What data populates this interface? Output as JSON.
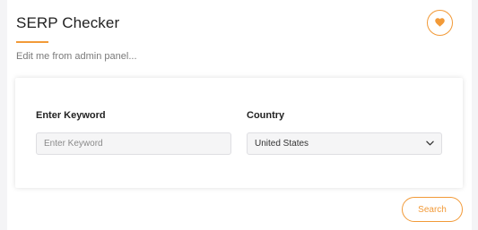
{
  "header": {
    "title": "SERP Checker",
    "subtitle": "Edit me from admin panel...",
    "favorite_icon": "heart-icon"
  },
  "form": {
    "keyword_label": "Enter Keyword",
    "keyword_placeholder": "Enter Keyword",
    "keyword_value": "",
    "country_label": "Country",
    "country_selected": "United States",
    "country_icon": "chevron-down-icon"
  },
  "actions": {
    "search_label": "Search"
  },
  "colors": {
    "accent": "#f29a38",
    "background": "#f4f4f6",
    "input_bg": "#f5f5f6"
  }
}
